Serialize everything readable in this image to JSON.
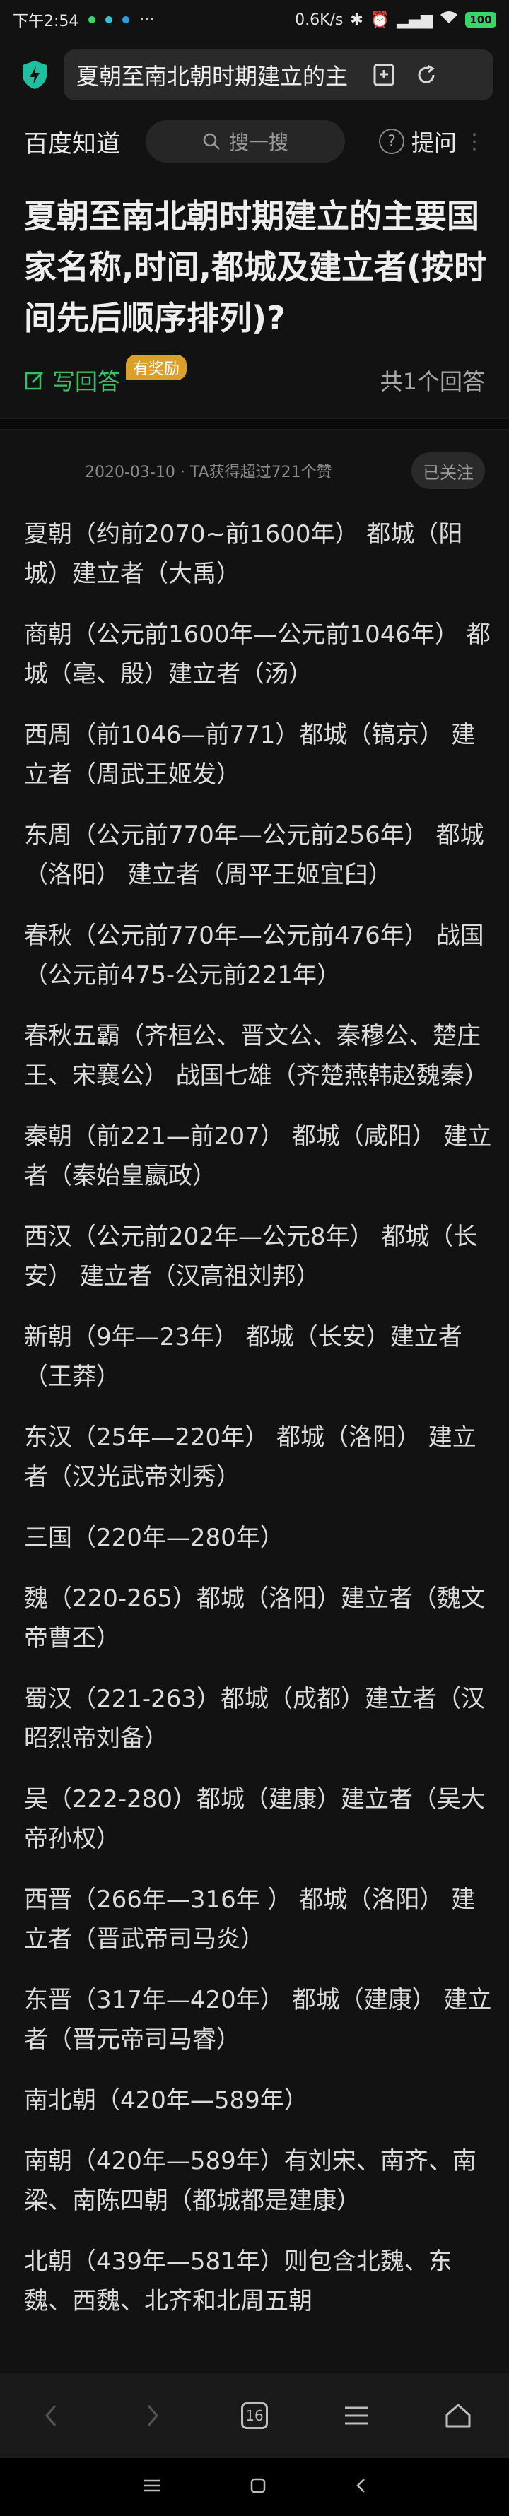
{
  "status": {
    "time": "下午2:54",
    "network_speed": "0.6K/s",
    "battery": "100"
  },
  "browser": {
    "url_text": "夏朝至南北朝时期建立的主"
  },
  "header": {
    "site_name": "百度知道",
    "search_placeholder": "搜一搜",
    "ask_label": "提问"
  },
  "question": {
    "title": "夏朝至南北朝时期建立的主要国家名称,时间,都城及建立者(按时间先后顺序排列)?",
    "write_answer_label": "写回答",
    "reward_badge": "有奖励",
    "answer_count": "共1个回答"
  },
  "answer": {
    "meta": "2020-03-10 · TA获得超过721个赞",
    "follow_label": "已关注",
    "paragraphs": [
      "夏朝（约前2070~前1600年） 都城（阳城）建立者（大禹）",
      "商朝（公元前1600年—公元前1046年） 都城（亳、殷）建立者（汤）",
      "西周（前1046—前771）都城（镐京） 建立者（周武王姬发）",
      "东周（公元前770年—公元前256年） 都城（洛阳） 建立者（周平王姬宜臼）",
      "春秋（公元前770年—公元前476年） 战国（公元前475-公元前221年）",
      "春秋五霸（齐桓公、晋文公、秦穆公、楚庄王、宋襄公） 战国七雄（齐楚燕韩赵魏秦）",
      "秦朝（前221—前207） 都城（咸阳） 建立者（秦始皇嬴政）",
      "西汉（公元前202年—公元8年） 都城（长安） 建立者（汉高祖刘邦）",
      "新朝（9年—23年） 都城（长安）建立者（王莽）",
      "东汉（25年—220年） 都城（洛阳） 建立者（汉光武帝刘秀）",
      "三国（220年—280年）",
      "魏（220-265）都城（洛阳）建立者（魏文帝曹丕）",
      "蜀汉（221-263）都城（成都）建立者（汉昭烈帝刘备）",
      "吴（222-280）都城（建康）建立者（吴大帝孙权）",
      "西晋（266年—316年 ） 都城（洛阳） 建立者（晋武帝司马炎）",
      "东晋（317年—420年） 都城（建康） 建立者（晋元帝司马睿）",
      "南北朝（420年—589年）",
      "南朝（420年—589年）有刘宋、南齐、南梁、南陈四朝（都城都是建康）",
      "北朝（439年—581年）则包含北魏、东魏、西魏、北齐和北周五朝"
    ]
  },
  "bottom_nav": {
    "tab_count": "16"
  },
  "colors": {
    "background": "#121212",
    "accent_green": "#3bbf67",
    "reward_gold": "#d9a02a",
    "shield_teal": "#1fbf9f"
  }
}
